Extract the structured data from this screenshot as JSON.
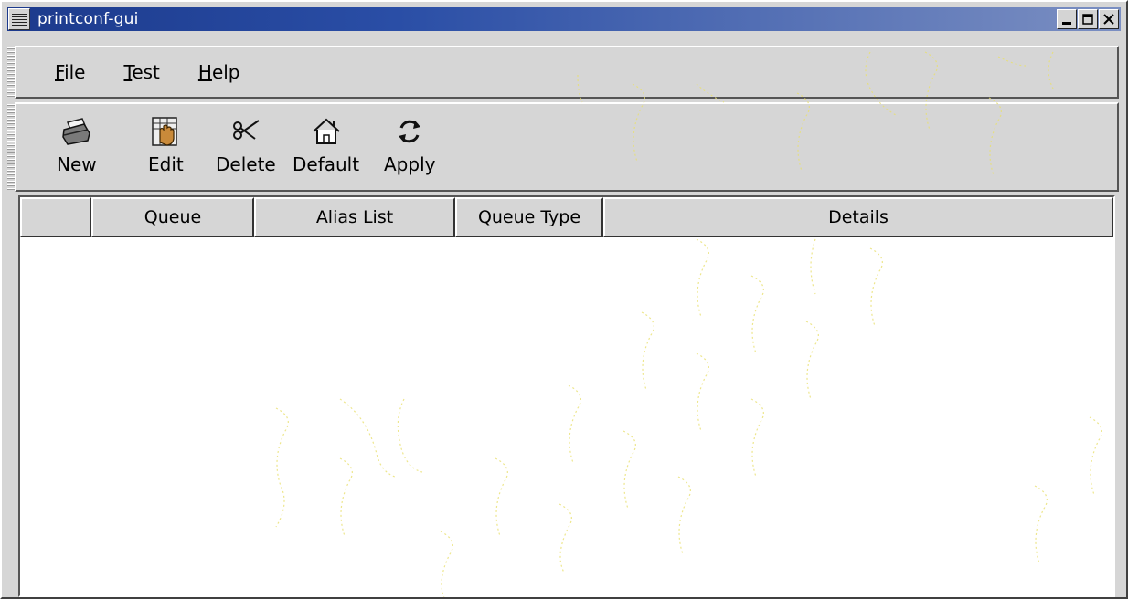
{
  "window": {
    "title": "printconf-gui",
    "title_color": "#ffffff",
    "titlebar_color": "#1c3a8c",
    "buttons": [
      "minimize",
      "maximize",
      "close"
    ]
  },
  "menubar": {
    "items": [
      {
        "mnemonic": "F",
        "rest": "ile"
      },
      {
        "mnemonic": "T",
        "rest": "est"
      },
      {
        "mnemonic": "H",
        "rest": "elp"
      }
    ]
  },
  "toolbar": {
    "buttons": [
      {
        "label": "New",
        "icon": "printer-icon"
      },
      {
        "label": "Edit",
        "icon": "edit-hand-icon"
      },
      {
        "label": "Delete",
        "icon": "scissors-icon"
      },
      {
        "label": "Default",
        "icon": "home-icon"
      },
      {
        "label": "Apply",
        "icon": "refresh-icon"
      }
    ]
  },
  "table": {
    "columns": [
      "",
      "Queue",
      "Alias List",
      "Queue Type",
      "Details"
    ],
    "rows": []
  }
}
